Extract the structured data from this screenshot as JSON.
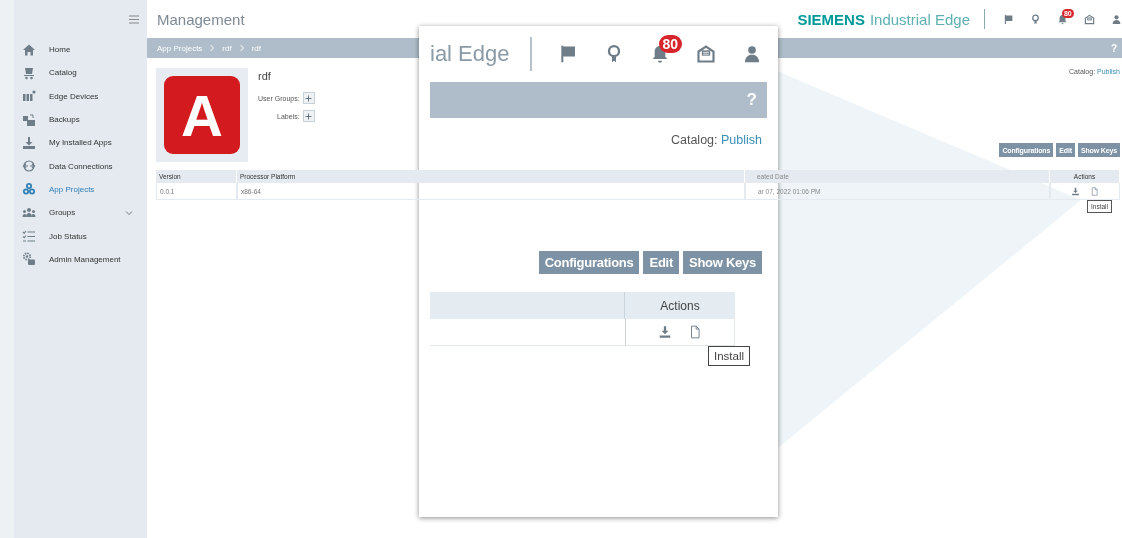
{
  "sidebar": {
    "items": [
      {
        "label": "Home",
        "selected": false,
        "kind": "link"
      },
      {
        "label": "Catalog",
        "selected": false,
        "kind": "link"
      },
      {
        "label": "Edge Devices",
        "selected": false,
        "kind": "link"
      },
      {
        "label": "Backups",
        "selected": false,
        "kind": "link"
      },
      {
        "label": "My Installed Apps",
        "selected": false,
        "kind": "link"
      },
      {
        "label": "Data Connections",
        "selected": false,
        "kind": "link"
      },
      {
        "label": "App Projects",
        "selected": true,
        "kind": "link"
      },
      {
        "label": "Groups",
        "selected": false,
        "kind": "group"
      },
      {
        "label": "Job Status",
        "selected": false,
        "kind": "link"
      },
      {
        "label": "Admin Management",
        "selected": false,
        "kind": "link"
      }
    ]
  },
  "header": {
    "title": "Management",
    "brand": "SIEMENS",
    "product": "Industrial Edge",
    "notification_count": "80"
  },
  "breadcrumb": {
    "items": [
      "App Projects",
      "rdf",
      "rdf"
    ],
    "help": "?"
  },
  "app": {
    "logo_letter": "A",
    "name": "rdf",
    "fields": [
      "User Groups:",
      "Labels:"
    ]
  },
  "catalog": {
    "label": "Catalog:",
    "value": "Publish"
  },
  "buttons": [
    "Configurations",
    "Edit",
    "Show Keys"
  ],
  "table": {
    "columns": [
      "Version",
      "Processor Platform",
      "eated Date",
      "Actions"
    ],
    "rows": [
      {
        "cells": [
          "0.0.1",
          "x86-64",
          "ar 07, 2022 01:06 PM"
        ]
      }
    ]
  },
  "tooltip": "Install",
  "callout": {
    "product": "ial Edge",
    "notification_count": "80",
    "help": "?",
    "catalog": {
      "label": "Catalog:",
      "value": "Publish"
    },
    "buttons": [
      "Configurations",
      "Edit",
      "Show Keys"
    ],
    "columns": [
      "Actions"
    ],
    "tooltip": "Install"
  }
}
